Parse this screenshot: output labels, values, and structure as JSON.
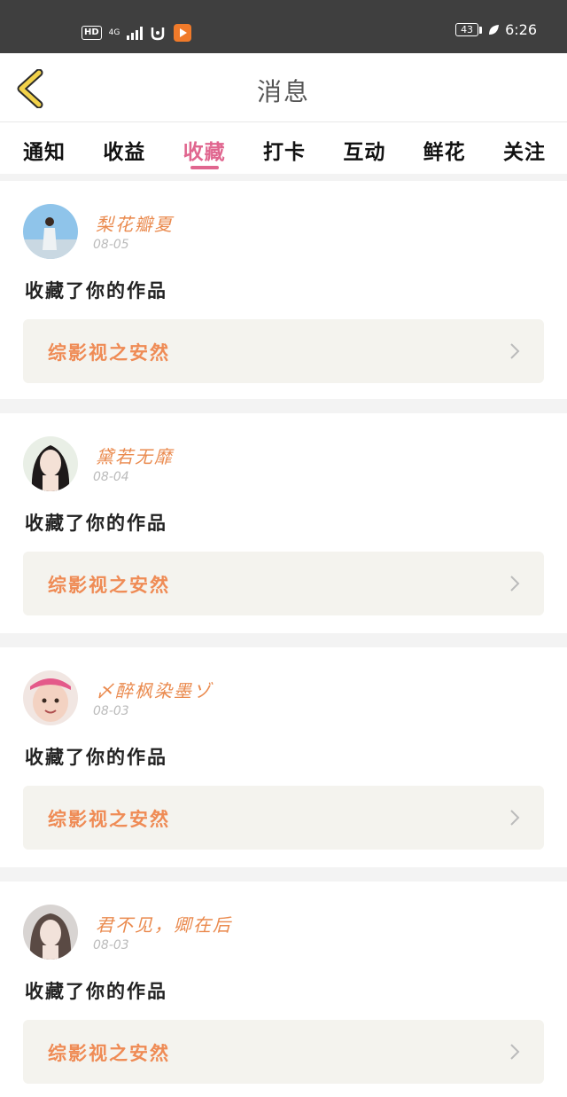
{
  "status_bar": {
    "hd": "HD",
    "network": "4G",
    "battery": "43",
    "time": "6:26"
  },
  "header": {
    "title": "消息"
  },
  "tabs": [
    {
      "label": "通知"
    },
    {
      "label": "收益"
    },
    {
      "label": "收藏"
    },
    {
      "label": "打卡"
    },
    {
      "label": "互动"
    },
    {
      "label": "鲜花"
    },
    {
      "label": "关注"
    }
  ],
  "active_tab": "收藏",
  "messages": [
    {
      "user": "梨花瓣夏",
      "date": "08-05",
      "action": "收藏了你的作品",
      "work": "综影视之安然"
    },
    {
      "user": "黛若无靡",
      "date": "08-04",
      "action": "收藏了你的作品",
      "work": "综影视之安然"
    },
    {
      "user": "〆醉枫染墨ゾ",
      "date": "08-03",
      "action": "收藏了你的作品",
      "work": "综影视之安然"
    },
    {
      "user": "君不见，卿在后",
      "date": "08-03",
      "action": "收藏了你的作品",
      "work": "综影视之安然"
    }
  ],
  "colors": {
    "accent_pink": "#e0668f",
    "name_orange": "#ea8a4e",
    "work_orange": "#ef8b55",
    "back_arrow": "#f2d24a"
  }
}
